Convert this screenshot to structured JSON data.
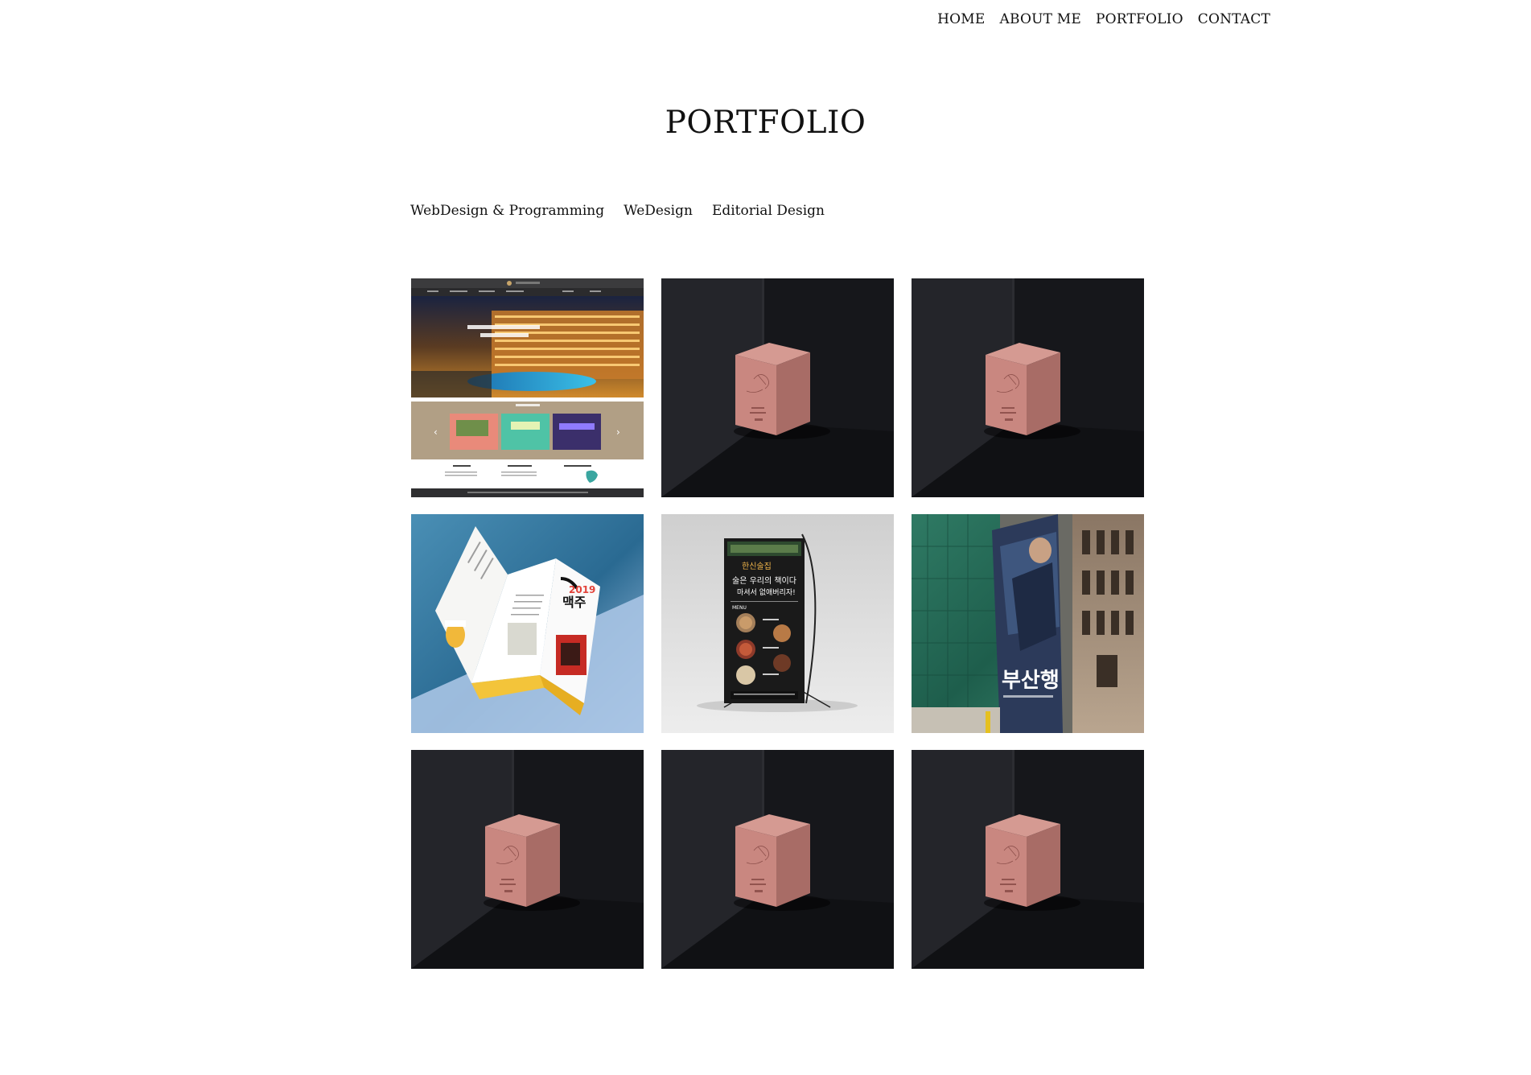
{
  "nav": {
    "items": [
      {
        "label": "HOME"
      },
      {
        "label": "ABOUT ME"
      },
      {
        "label": "PORTFOLIO"
      },
      {
        "label": "CONTACT"
      }
    ]
  },
  "page_title": "PORTFOLIO",
  "filters": [
    {
      "label": "WebDesign & Programming"
    },
    {
      "label": "WeDesign"
    },
    {
      "label": "Editorial Design"
    }
  ],
  "gallery": {
    "items": [
      {
        "kind": "website-mockup"
      },
      {
        "kind": "pink-box-mockup"
      },
      {
        "kind": "pink-box-mockup"
      },
      {
        "kind": "trifold-brochure-mockup"
      },
      {
        "kind": "x-banner-mockup"
      },
      {
        "kind": "billboard-poster-mockup"
      },
      {
        "kind": "pink-box-mockup"
      },
      {
        "kind": "pink-box-mockup"
      },
      {
        "kind": "pink-box-mockup"
      }
    ]
  },
  "colors": {
    "background": "#ffffff",
    "text": "#111111",
    "box_pink": "#c98780",
    "dark_room": "#1c1d21"
  }
}
